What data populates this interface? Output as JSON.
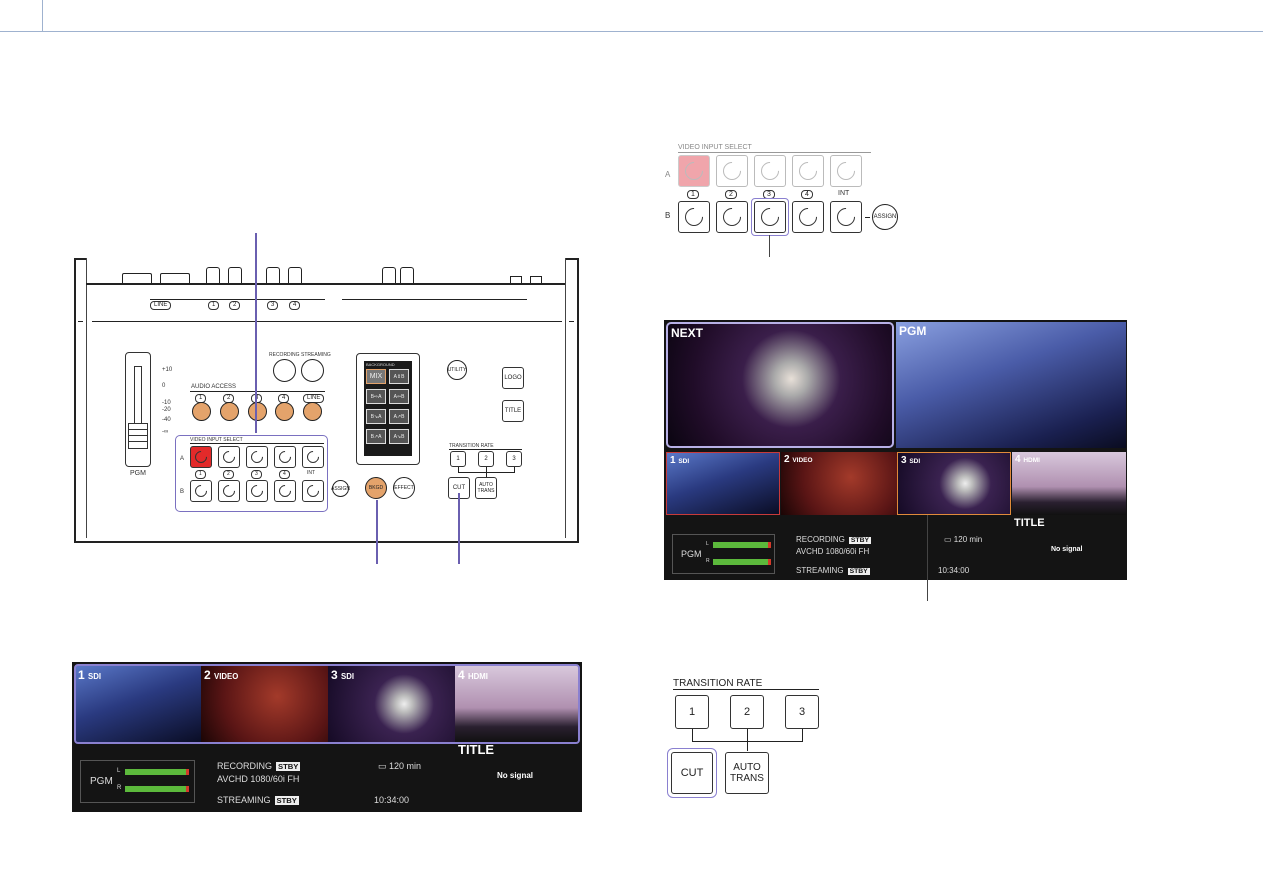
{
  "device": {
    "jacks_labels": [
      "LINE",
      "1",
      "2",
      "3",
      "4"
    ],
    "fader": {
      "label": "PGM",
      "scale": [
        "+10",
        "0",
        "-10",
        "-20",
        "-40",
        "-∞"
      ]
    },
    "audio_access": {
      "title": "AUDIO ACCESS",
      "buttons": [
        "1",
        "2",
        "3",
        "4",
        "LINE"
      ]
    },
    "recording_label": "RECORDING",
    "streaming_label": "STREAMING",
    "video_input_select": {
      "title": "VIDEO INPUT SELECT",
      "row_a_label": "A",
      "row_b_label": "B",
      "inputs": [
        "1",
        "2",
        "3",
        "4",
        "INT"
      ],
      "active_a": "1",
      "active_b": "3"
    },
    "assign_label": "ASSIGN",
    "bkgd_label": "BKGD",
    "effect_label": "EFFECT",
    "background_panel": {
      "title": "BACKGROUND",
      "buttons": [
        "MIX",
        "A⇕B",
        "B⇨A",
        "A⇦B",
        "B↘A",
        "A↗B",
        "B↗A",
        "A↘B"
      ]
    },
    "utility_label": "UTILITY",
    "logo_label": "LOGO",
    "title_label": "TITLE",
    "transition_rate": {
      "title": "TRANSITION RATE",
      "buttons": [
        "1",
        "2",
        "3"
      ],
      "active": "1"
    },
    "cut_label": "CUT",
    "auto_trans_label": "AUTO TRANS"
  },
  "zoom_vis": {
    "title": "VIDEO INPUT SELECT",
    "row_a_label": "A",
    "row_b_label": "B",
    "inputs": [
      "1",
      "2",
      "3",
      "4",
      "INT"
    ],
    "assign_label": "ASSIGN"
  },
  "monitor": {
    "next_label": "NEXT",
    "pgm_label": "PGM",
    "inputs": [
      {
        "num": "1",
        "type": "SDI"
      },
      {
        "num": "2",
        "type": "VIDEO"
      },
      {
        "num": "3",
        "type": "SDI"
      },
      {
        "num": "4",
        "type": "HDMI"
      }
    ],
    "title_label": "TITLE",
    "meter_label": "PGM",
    "meter_l": "L",
    "meter_r": "R",
    "meter_level_l": 0.95,
    "meter_level_r": 0.95,
    "recording_label": "RECORDING",
    "recording_status": "STBY",
    "format": "AVCHD  1080/60i FH",
    "streaming_label": "STREAMING",
    "streaming_status": "STBY",
    "remaining": "120 min",
    "timecode": "10:34:00",
    "no_signal": "No signal"
  },
  "transition_zoom": {
    "title": "TRANSITION RATE",
    "buttons": [
      "1",
      "2",
      "3"
    ],
    "cut_label": "CUT",
    "auto_label_1": "AUTO",
    "auto_label_2": "TRANS"
  },
  "colors": {
    "accent_orange": "#e4a36b",
    "active_red": "#e32a2a",
    "callout": "#6a5fb0",
    "meter_green": "#5cb93c"
  }
}
